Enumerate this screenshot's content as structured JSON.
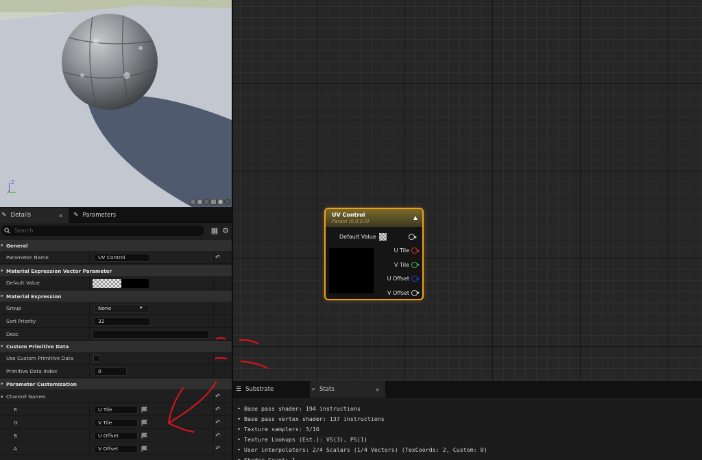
{
  "details": {
    "tabs": [
      {
        "label": "Details",
        "close": "×"
      },
      {
        "label": "Parameters"
      }
    ],
    "search_placeholder": "Search",
    "categories": {
      "general": "General",
      "vector_param": "Material Expression Vector Parameter",
      "expression": "Material Expression",
      "custom_primitive": "Custom Primitive Data",
      "param_custom": "Parameter Customization"
    },
    "props": {
      "parameter_name": {
        "label": "Parameter Name",
        "value": "UV Control"
      },
      "default_value": {
        "label": "Default Value"
      },
      "group": {
        "label": "Group",
        "value": "None"
      },
      "sort_priority": {
        "label": "Sort Priority",
        "value": "32"
      },
      "desc": {
        "label": "Desc",
        "value": ""
      },
      "use_custom_primitive": {
        "label": "Use Custom Primitive Data"
      },
      "primitive_index": {
        "label": "Primitive Data Index",
        "value": "0"
      },
      "channel_names": {
        "label": "Channel Names"
      }
    },
    "channels": [
      {
        "label": "R",
        "value": "U Tile"
      },
      {
        "label": "G",
        "value": "V Tile"
      },
      {
        "label": "B",
        "value": "U Offset"
      },
      {
        "label": "A",
        "value": "V Offset"
      }
    ]
  },
  "node": {
    "title": "UV Control",
    "subtitle": "Param (0,0,0,0)",
    "default_label": "Default Value",
    "outputs": [
      {
        "label": "U Tile",
        "color": "#e0312a"
      },
      {
        "label": "V Tile",
        "color": "#3fbf3f"
      },
      {
        "label": "U Offset",
        "color": "#2a3fd0"
      },
      {
        "label": "V Offset",
        "color": "#dddddd"
      }
    ]
  },
  "stats": {
    "tabs": [
      {
        "label": "Substrate"
      },
      {
        "label": "Stats",
        "close": "×"
      }
    ],
    "lines": [
      "Base pass shader: 194 instructions",
      "Base pass vertex shader: 137 instructions",
      "Texture samplers: 3/16",
      "Texture Lookups (Est.): VS(3), PS(1)",
      "User interpolators: 2/4 Scalars (1/4 Vectors) (TexCoords: 2, Custom: 0)",
      "Shader Count: 1"
    ]
  },
  "viewport": {
    "axis": "Z",
    "colors": {
      "floor": "#c3c8d0",
      "shadow": "#4f5a6e",
      "sphere": "#8d9195"
    }
  },
  "accent": "#f0a31a"
}
